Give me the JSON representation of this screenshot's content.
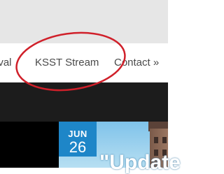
{
  "nav": {
    "items": [
      {
        "label": "ival"
      },
      {
        "label": "KSST Stream"
      },
      {
        "label": "Contact »"
      }
    ]
  },
  "post": {
    "month": "JUN",
    "day": "26",
    "headline": "\"Update"
  },
  "colors": {
    "top_bar": "#e6e6e6",
    "nav_text": "#4a4a4a",
    "dark_bar": "#1c1c1c",
    "date_badge": "#1e86c8",
    "annotation_ellipse": "#d0202a"
  }
}
